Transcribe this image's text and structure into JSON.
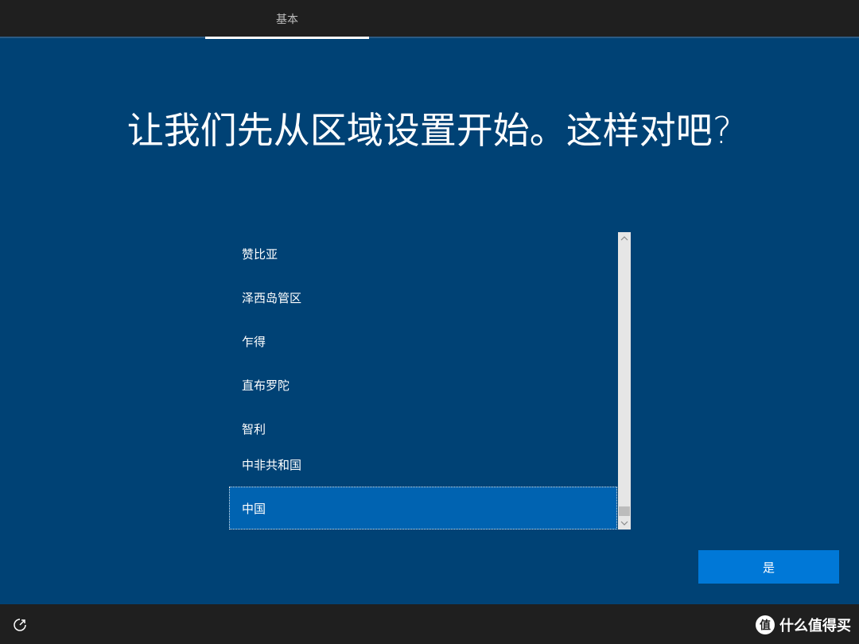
{
  "header": {
    "tab_label": "基本"
  },
  "main": {
    "title": "让我们先从区域设置开始。这样对吧?",
    "regions": [
      {
        "label": "赞比亚",
        "selected": false
      },
      {
        "label": "泽西岛管区",
        "selected": false
      },
      {
        "label": "乍得",
        "selected": false
      },
      {
        "label": "直布罗陀",
        "selected": false
      },
      {
        "label": "智利",
        "selected": false
      },
      {
        "label": "中非共和国",
        "selected": false
      },
      {
        "label": "中国",
        "selected": true
      }
    ],
    "scroll_position": 0.97
  },
  "footer": {
    "yes_label": "是",
    "accessibility_icon": "accessibility-icon",
    "watermark_logo": "值",
    "watermark_text": "什么值得买"
  },
  "colors": {
    "background": "#004275",
    "selected": "#0063b1",
    "button": "#0078d7",
    "bars": "#1f1f1f"
  }
}
